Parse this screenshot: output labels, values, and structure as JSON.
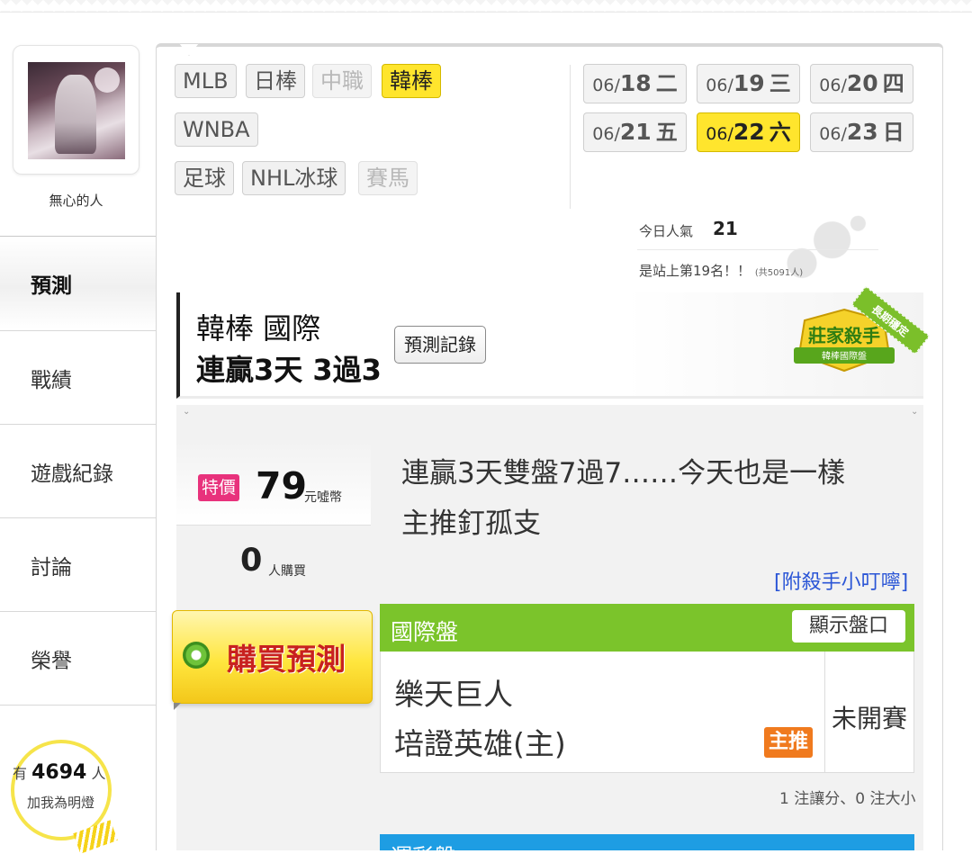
{
  "user": {
    "name": "無心的人"
  },
  "nav": {
    "items": [
      {
        "label": "預測",
        "active": true
      },
      {
        "label": "戰績",
        "active": false
      },
      {
        "label": "遊戲紀錄",
        "active": false
      },
      {
        "label": "討論",
        "active": false
      },
      {
        "label": "榮譽",
        "active": false
      }
    ]
  },
  "fans": {
    "prefix": "有",
    "count": "4694",
    "suffix": "人",
    "action": "加我為明燈"
  },
  "sports": [
    {
      "label": "MLB",
      "state": "normal"
    },
    {
      "label": "日棒",
      "state": "normal"
    },
    {
      "label": "中職",
      "state": "disabled"
    },
    {
      "label": "韓棒",
      "state": "selected"
    },
    {
      "label": "WNBA",
      "state": "normal"
    },
    {
      "label": "足球",
      "state": "normal"
    },
    {
      "label": "NHL冰球",
      "state": "normal"
    },
    {
      "label": "賽馬",
      "state": "disabled"
    }
  ],
  "dates": [
    {
      "md": "06/",
      "day": "18",
      "wd": "二",
      "selected": false
    },
    {
      "md": "06/",
      "day": "19",
      "wd": "三",
      "selected": false
    },
    {
      "md": "06/",
      "day": "20",
      "wd": "四",
      "selected": false
    },
    {
      "md": "06/",
      "day": "21",
      "wd": "五",
      "selected": false
    },
    {
      "md": "06/",
      "day": "22",
      "wd": "六",
      "selected": true
    },
    {
      "md": "06/",
      "day": "23",
      "wd": "日",
      "selected": false
    }
  ],
  "popularity": {
    "label": "今日人氣",
    "value": "21",
    "rank": "是站上第19名！！",
    "rank_total": "(共5091人)"
  },
  "banner": {
    "category": "韓棒 國際",
    "streak": "連贏3天 3過3",
    "record_button": "預測記錄",
    "badge_title": "莊家殺手",
    "badge_sub": "韓棒國際盤",
    "badge_ribbon": "長期穩定"
  },
  "offer": {
    "tag": "特價",
    "price": "79",
    "unit": "元噓幣",
    "buyers": "0",
    "buyers_unit": "人購買",
    "buy_button": "購買預測"
  },
  "message": {
    "line1": "連贏3天雙盤7過7……今天也是一樣",
    "line2": "主推釘孤支",
    "tips_link": "[附殺手小叮嚀]"
  },
  "game": {
    "market": "國際盤",
    "show_odds": "顯示盤口",
    "team_away": "樂天巨人",
    "team_home": "培證英雄(主)",
    "pick_tag": "主推",
    "status": "未開賽",
    "summary": "1 注讓分、0 注大小"
  },
  "next_section": {
    "title": "運彩盤"
  },
  "colors": {
    "highlight_yellow": "#ffe52d",
    "market_green": "#7bc42b",
    "pick_orange": "#f07a1e",
    "special_pink": "#e8327c",
    "link_blue": "#2a55d6",
    "next_blue": "#1e9de3"
  }
}
